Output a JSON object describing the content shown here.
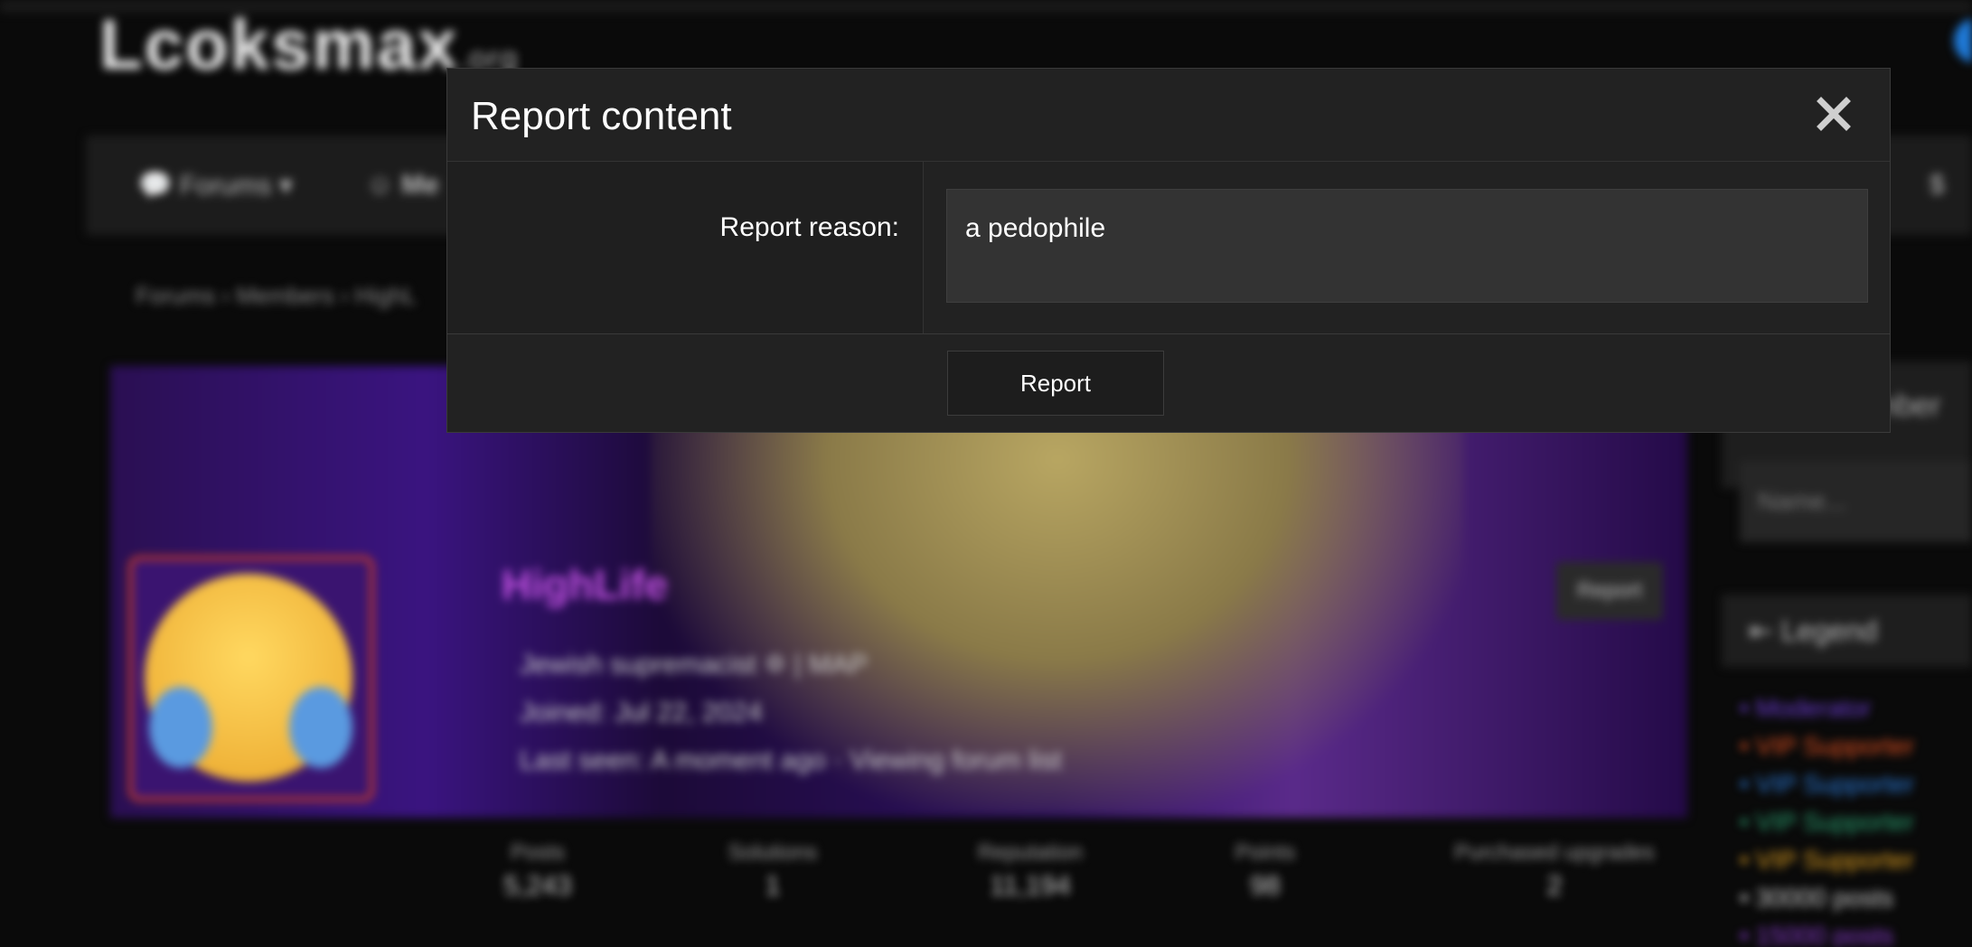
{
  "background_page": {
    "logo_text": "Lcoksmax",
    "logo_suffix": ".org",
    "nav": {
      "forums_label": "Forums",
      "members_label": "Me"
    },
    "breadcrumb": "Forums  ›  Members  ›  HighL",
    "profile": {
      "username": "HighLife",
      "report_label": "Report",
      "title_line": "Jewish supremacist ✡ | MAP",
      "joined_line": "Joined: Jul 22, 2024",
      "last_seen_line": "Last seen: A moment ago · Viewing forum list"
    },
    "stats": [
      {
        "label": "Posts",
        "value": "5,243"
      },
      {
        "label": "Solutions",
        "value": "1"
      },
      {
        "label": "Reputation",
        "value": "11,194"
      },
      {
        "label": "Points",
        "value": "98"
      },
      {
        "label": "Purchased upgrades",
        "value": "2"
      }
    ],
    "sidebar": {
      "member_text": "mber",
      "name_placeholder": "Name...",
      "legend_title": "Legend",
      "legend_items": [
        {
          "label": "• Moderator",
          "color": "#6a3ad0"
        },
        {
          "label": "• VIP Supporter",
          "color": "#e05020"
        },
        {
          "label": "• VIP Supporter",
          "color": "#2a7ad8"
        },
        {
          "label": "• VIP Supporter",
          "color": "#2aa070"
        },
        {
          "label": "• VIP Supporter",
          "color": "#e0a020"
        },
        {
          "label": "• 30000 posts",
          "color": "#cccccc"
        },
        {
          "label": "• 15000 posts",
          "color": "#8a3ad0"
        }
      ]
    }
  },
  "modal": {
    "title": "Report content",
    "close_icon": "close-icon",
    "reason_label": "Report reason:",
    "reason_value": "a pedophile",
    "submit_label": "Report"
  }
}
